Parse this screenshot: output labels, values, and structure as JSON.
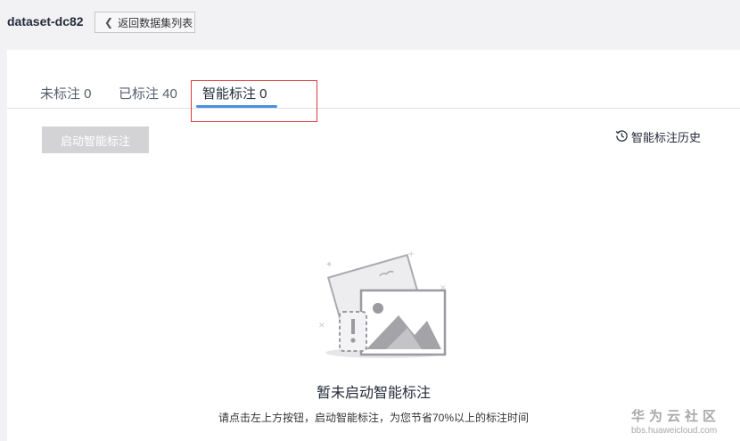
{
  "header": {
    "dataset_name": "dataset-dc82",
    "back_label": "返回数据集列表",
    "back_icon": "chevron-left-icon"
  },
  "tabs": [
    {
      "label": "未标注 0",
      "active": false
    },
    {
      "label": "已标注 40",
      "active": false
    },
    {
      "label": "智能标注 0",
      "active": true
    }
  ],
  "toolbar": {
    "start_label": "启动智能标注",
    "history_label": "智能标注历史",
    "history_icon": "history-clock-icon"
  },
  "empty_state": {
    "title": "暂未启动智能标注",
    "description": "请点击左上方按钮，启动智能标注，为您节省70%以上的标注时间"
  },
  "watermark": {
    "title": "华为云社区",
    "url": "bbs.huaweicloud.com"
  },
  "colors": {
    "accent": "#4a90e2",
    "highlight_box": "#e0393e",
    "disabled_button": "#d3d3d6"
  }
}
